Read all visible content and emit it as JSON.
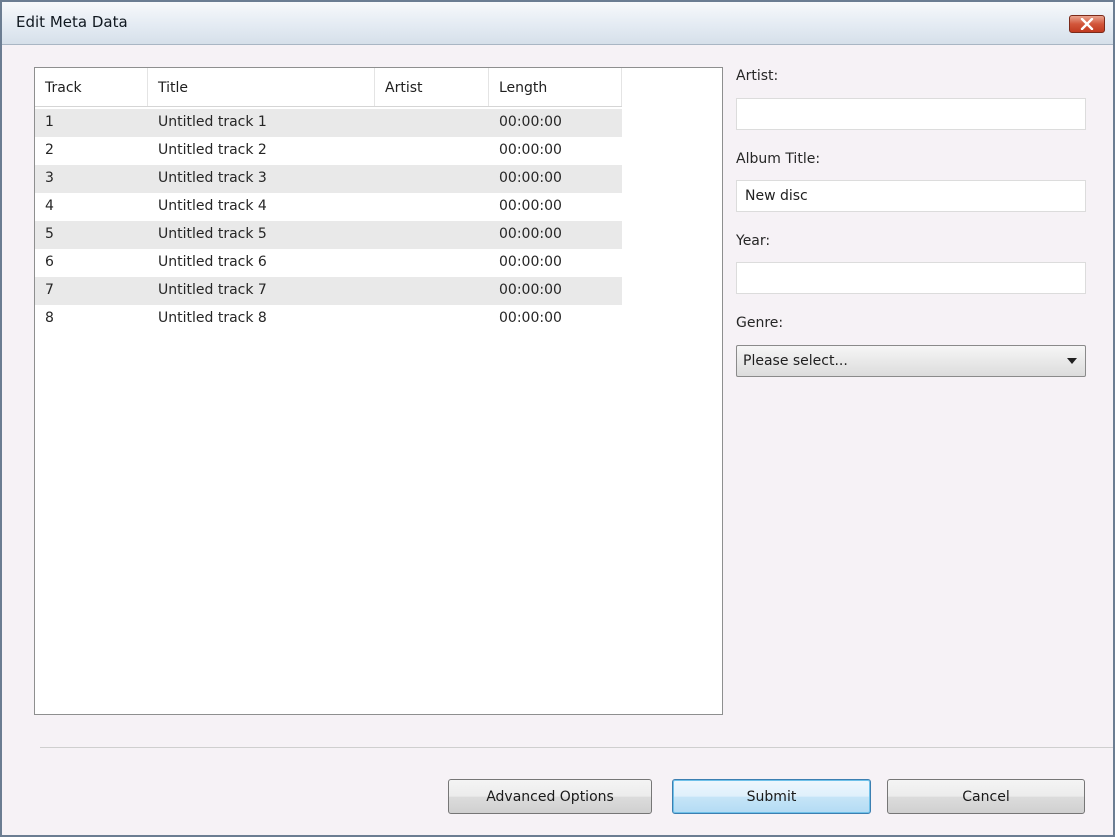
{
  "window": {
    "title": "Edit Meta Data"
  },
  "tracklist": {
    "columns": [
      "Track",
      "Title",
      "Artist",
      "Length"
    ],
    "rows": [
      {
        "track": "1",
        "title": "Untitled track 1",
        "artist": "",
        "length": "00:00:00"
      },
      {
        "track": "2",
        "title": "Untitled track 2",
        "artist": "",
        "length": "00:00:00"
      },
      {
        "track": "3",
        "title": "Untitled track 3",
        "artist": "",
        "length": "00:00:00"
      },
      {
        "track": "4",
        "title": "Untitled track 4",
        "artist": "",
        "length": "00:00:00"
      },
      {
        "track": "5",
        "title": "Untitled track 5",
        "artist": "",
        "length": "00:00:00"
      },
      {
        "track": "6",
        "title": "Untitled track 6",
        "artist": "",
        "length": "00:00:00"
      },
      {
        "track": "7",
        "title": "Untitled track 7",
        "artist": "",
        "length": "00:00:00"
      },
      {
        "track": "8",
        "title": "Untitled track 8",
        "artist": "",
        "length": "00:00:00"
      }
    ]
  },
  "form": {
    "artist_label": "Artist:",
    "artist_value": "",
    "album_title_label": "Album Title:",
    "album_title_value": "New disc",
    "year_label": "Year:",
    "year_value": "",
    "genre_label": "Genre:",
    "genre_value": "Please select..."
  },
  "buttons": {
    "advanced": "Advanced Options",
    "submit": "Submit",
    "cancel": "Cancel"
  },
  "colors": {
    "close_button": "#c9452b",
    "row_alternate": "#e9e9e9",
    "default_button_border": "#3c7fb1"
  }
}
